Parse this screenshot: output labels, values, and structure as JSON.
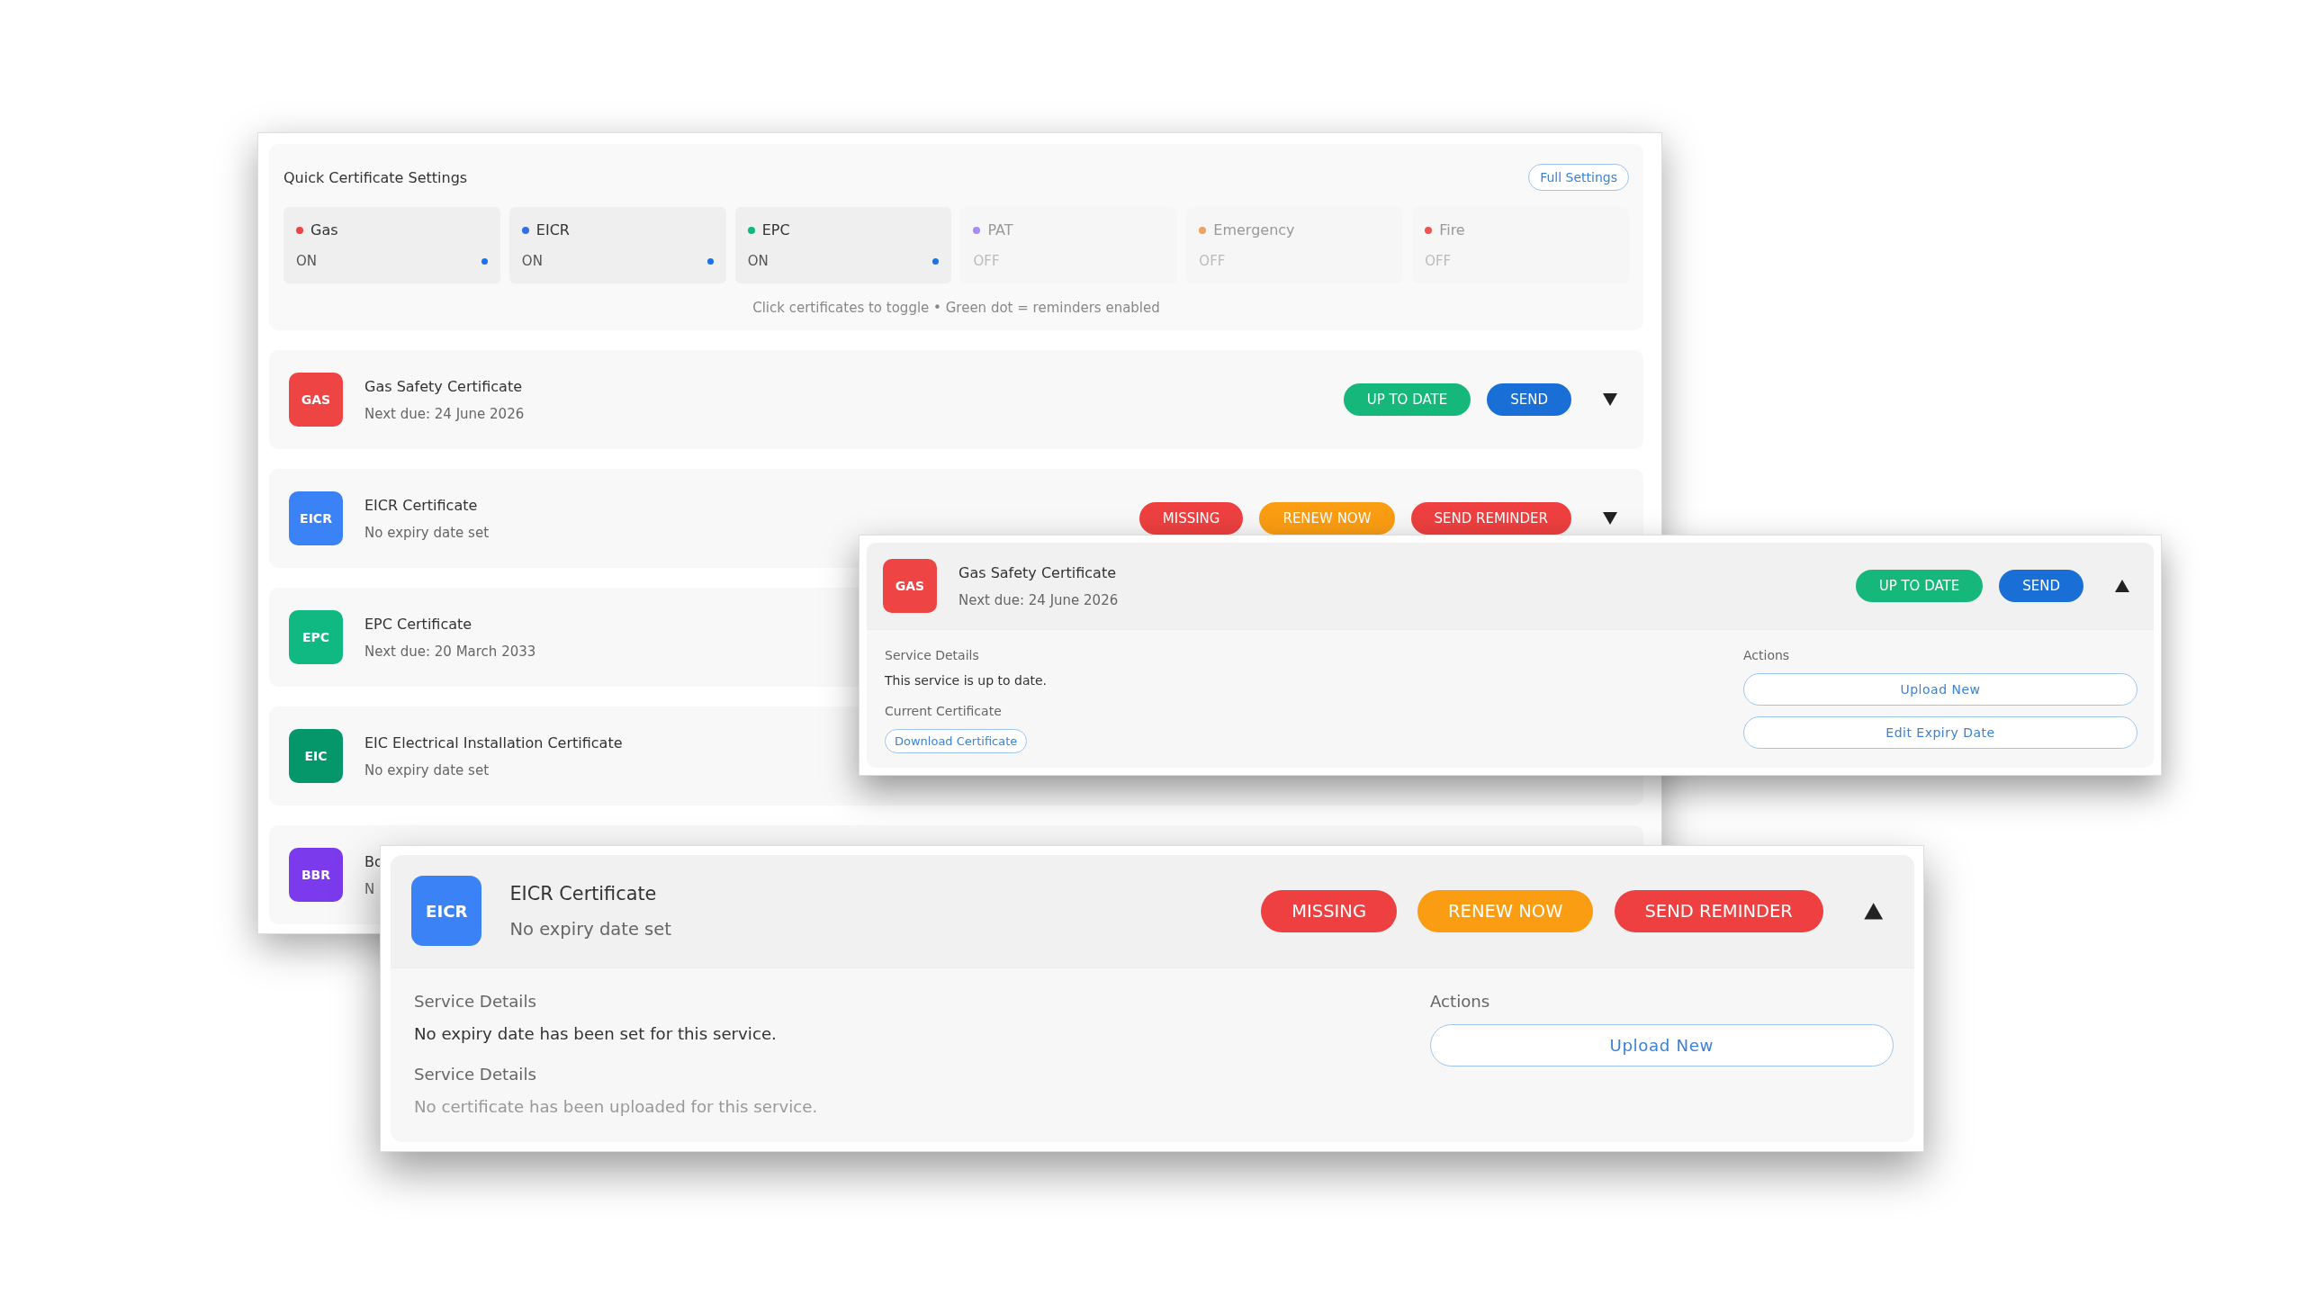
{
  "settings": {
    "title": "Quick Certificate Settings",
    "action": "Full Settings",
    "items": [
      {
        "name": "Gas",
        "color": "#ef4444",
        "on": true,
        "state": "ON"
      },
      {
        "name": "EICR",
        "color": "#2f6fe8",
        "on": true,
        "state": "ON"
      },
      {
        "name": "EPC",
        "color": "#10b981",
        "on": true,
        "state": "ON"
      },
      {
        "name": "PAT",
        "color": "#a78bfa",
        "on": false,
        "state": "OFF"
      },
      {
        "name": "Emergency",
        "color": "#f4a261",
        "on": false,
        "state": "OFF"
      },
      {
        "name": "Fire",
        "color": "#ef5350",
        "on": false,
        "state": "OFF"
      }
    ],
    "hint": "Click certificates to toggle • Green dot = reminders enabled"
  },
  "services": [
    {
      "code": "GAS",
      "color": "#ef4444",
      "title": "Gas Safety Certificate",
      "subtitle": "Next due: 24 June 2026",
      "badges": [
        {
          "label": "UP TO DATE",
          "kind": "success"
        },
        {
          "label": "SEND",
          "kind": "info"
        }
      ],
      "expanded": false
    },
    {
      "code": "EICR",
      "color": "#3b82f6",
      "title": "EICR Certificate",
      "subtitle": "No expiry date set",
      "badges": [
        {
          "label": "MISSING",
          "kind": "danger"
        },
        {
          "label": "RENEW NOW",
          "kind": "warning"
        },
        {
          "label": "SEND REMINDER",
          "kind": "danger"
        }
      ],
      "expanded": false
    },
    {
      "code": "EPC",
      "color": "#10b981",
      "title": "EPC Certificate",
      "subtitle": "Next due: 20 March 2033"
    },
    {
      "code": "EIC",
      "color": "#059669",
      "title": "EIC Electrical Installation Certificate",
      "subtitle": "No expiry date set"
    },
    {
      "code": "BBR",
      "color": "#7c3aed",
      "title": "Bo",
      "subtitle": "N"
    }
  ],
  "detail_panels": [
    {
      "code": "GAS",
      "color": "#ef4444",
      "title": "Gas Safety Certificate",
      "subtitle": "Next due: 24 June 2026",
      "badges": [
        {
          "label": "UP TO DATE",
          "kind": "success"
        },
        {
          "label": "SEND",
          "kind": "info"
        }
      ],
      "expanded": true,
      "sections": [
        {
          "heading": "Service Details",
          "kind": "text",
          "text": "This service is up to date."
        },
        {
          "heading": "Current Certificate",
          "kind": "link",
          "text": "Download Certificate"
        }
      ],
      "actions_heading": "Actions",
      "actions": [
        "Upload New",
        "Edit Expiry Date"
      ]
    },
    {
      "code": "EICR",
      "color": "#3b82f6",
      "title": "EICR Certificate",
      "subtitle": "No expiry date set",
      "badges": [
        {
          "label": "MISSING",
          "kind": "danger"
        },
        {
          "label": "RENEW NOW",
          "kind": "warning"
        },
        {
          "label": "SEND REMINDER",
          "kind": "danger"
        }
      ],
      "expanded": true,
      "sections": [
        {
          "heading": "Service Details",
          "kind": "text",
          "text": "No expiry date has been set for this service."
        },
        {
          "heading": "Service Details",
          "kind": "note",
          "text": "No certificate has been uploaded for this service."
        }
      ],
      "actions_heading": "Actions",
      "actions": [
        "Upload New"
      ]
    }
  ]
}
